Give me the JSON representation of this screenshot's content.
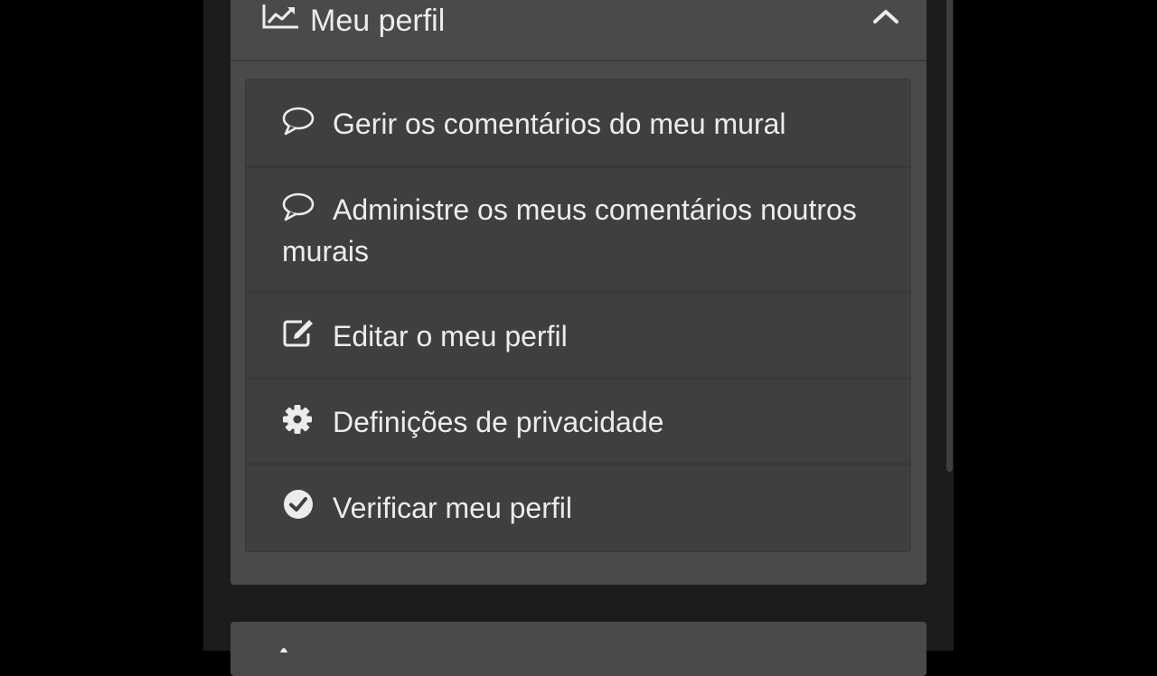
{
  "panel": {
    "title": "Meu perfil",
    "title_icon": "chart-line-icon",
    "toggle_icon": "chevron-up-icon",
    "expanded": true
  },
  "menu": {
    "items": [
      {
        "label": "Gerir os comentários do meu mural",
        "icon": "comment-icon"
      },
      {
        "label": "Administre os meus comentários noutros murais",
        "icon": "comment-icon"
      },
      {
        "label": "Editar o meu perfil",
        "icon": "edit-icon"
      },
      {
        "label": "Definições de privacidade",
        "icon": "gear-icon"
      },
      {
        "label": "Verificar meu perfil",
        "icon": "check-circle-icon"
      }
    ]
  },
  "colors": {
    "page_background": "#000000",
    "sidebar_background": "#1c1c1c",
    "panel_background": "#4a4a4a",
    "menu_background": "#3f3f3f",
    "text": "#ececec"
  }
}
